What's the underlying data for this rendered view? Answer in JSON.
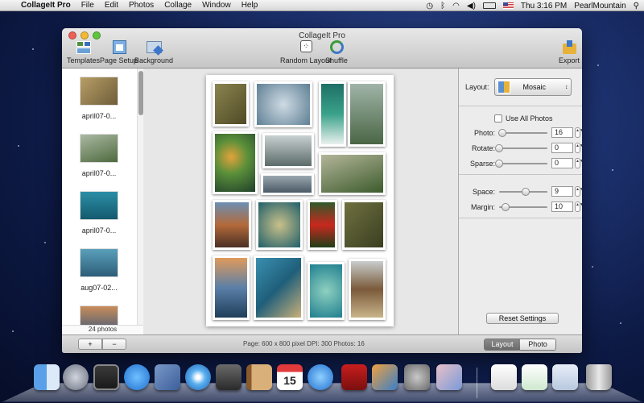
{
  "menubar": {
    "app_name": "CollageIt Pro",
    "menus": [
      "File",
      "Edit",
      "Photos",
      "Collage",
      "Window",
      "Help"
    ],
    "clock": "Thu 3:16 PM",
    "user": "PearlMountain"
  },
  "window": {
    "title": "CollageIt Pro",
    "toolbar": {
      "templates": "Templates",
      "page_setup": "Page Setup",
      "background": "Background",
      "random_layout": "Random Layout",
      "shuffle": "Shuffle",
      "export": "Export"
    }
  },
  "sidebar": {
    "items": [
      {
        "label": "april07-0...",
        "color": "#8f7a4e"
      },
      {
        "label": "april07-0...",
        "color": "#5e7a52"
      },
      {
        "label": "april07-0...",
        "color": "#2f7f93"
      },
      {
        "label": "aug07-02...",
        "color": "#4f8fa8"
      },
      {
        "label": "",
        "color": "#7f6a5a"
      }
    ],
    "count": "24 photos"
  },
  "photos": [
    {
      "color": "#6d6a3a"
    },
    {
      "color": "#6f8ea3"
    },
    {
      "color": "#1f7f6a"
    },
    {
      "color": "#5a6f55"
    },
    {
      "color": "#6e7e3f"
    },
    {
      "color": "#8f9a9a"
    },
    {
      "color": "#5f7280"
    },
    {
      "color": "#4d6a3c"
    },
    {
      "color": "#8a5e4a"
    },
    {
      "color": "#2f6a72"
    },
    {
      "color": "#3d5e2e"
    },
    {
      "color": "#58623a"
    },
    {
      "color": "#4d6f93"
    },
    {
      "color": "#2f6f8f"
    },
    {
      "color": "#2a7f8f"
    },
    {
      "color": "#7a6a55"
    }
  ],
  "panel": {
    "layout_label": "Layout:",
    "layout_value": "Mosaic",
    "use_all_label": "Use All Photos",
    "photo_label": "Photo:",
    "photo_value": "16",
    "rotate_label": "Rotate:",
    "rotate_value": "0",
    "sparse_label": "Sparse:",
    "sparse_value": "0",
    "space_label": "Space:",
    "space_value": "9",
    "margin_label": "Margin:",
    "margin_value": "10",
    "reset_label": "Reset Settings"
  },
  "bottombar": {
    "add": "+",
    "remove": "−",
    "status": "Page: 600 x 800 pixel DPI: 300 Photos: 16",
    "tab_layout": "Layout",
    "tab_photo": "Photo"
  },
  "colors": {
    "accent_blue": "#3d77c9",
    "dock_calendar_day": "15"
  }
}
